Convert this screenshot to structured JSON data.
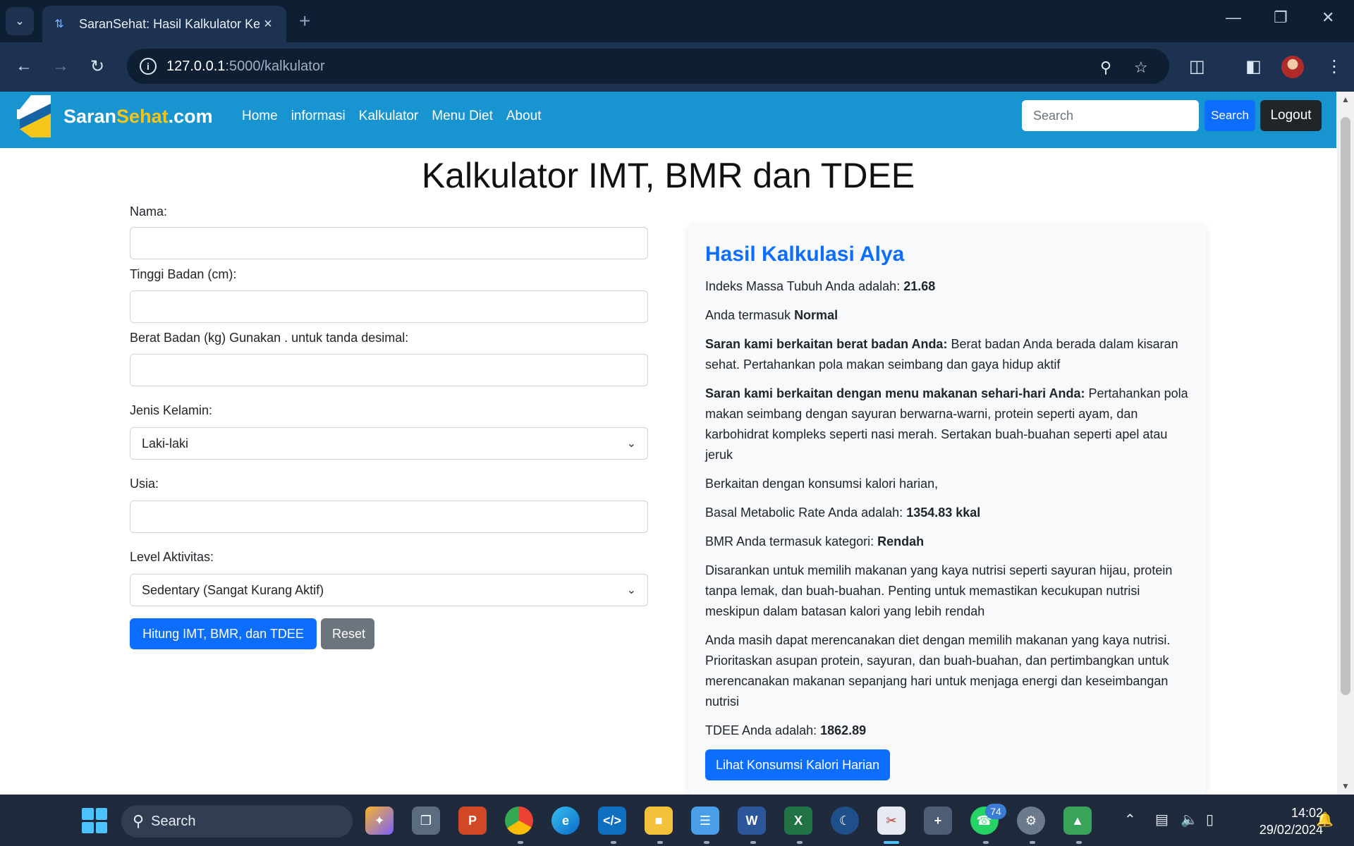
{
  "browser": {
    "tab_title": "SaranSehat: Hasil Kalkulator Ke",
    "url_host": "127.0.0.1",
    "url_path": ":5000/kalkulator"
  },
  "site": {
    "brand_part1": "Saran",
    "brand_part2": "Sehat",
    "brand_part3": ".com",
    "nav": [
      "Home",
      "informasi",
      "Kalkulator",
      "Menu Diet",
      "About"
    ],
    "search_placeholder": "Search",
    "search_button": "Search",
    "logout_button": "Logout",
    "brand_accent": "#f5c518",
    "navbar_color": "#1894d0"
  },
  "page": {
    "title": "Kalkulator IMT, BMR dan TDEE"
  },
  "form": {
    "nama_label": "Nama:",
    "tinggi_label": "Tinggi Badan (cm):",
    "berat_label": "Berat Badan (kg) Gunakan . untuk tanda desimal:",
    "jenis_kelamin_label": "Jenis Kelamin:",
    "jenis_kelamin_value": "Laki-laki",
    "usia_label": "Usia:",
    "aktivitas_label": "Level Aktivitas:",
    "aktivitas_value": "Sedentary (Sangat Kurang Aktif)",
    "hitung_button": "Hitung IMT, BMR, dan TDEE",
    "reset_button": "Reset"
  },
  "result": {
    "heading": "Hasil Kalkulasi Alya",
    "imt_text": "Indeks Massa Tubuh Anda adalah: ",
    "imt_value": "21.68",
    "kategori_text": "Anda termasuk ",
    "kategori_value": "Normal",
    "saran_berat_bold": "Saran kami berkaitan berat badan Anda:",
    "saran_berat_text": " Berat badan Anda berada dalam kisaran sehat. Pertahankan pola makan seimbang dan gaya hidup aktif",
    "saran_menu_bold": "Saran kami berkaitan dengan menu makanan sehari-hari Anda:",
    "saran_menu_text": " Pertahankan pola makan seimbang dengan sayuran berwarna-warni, protein seperti ayam, dan karbohidrat kompleks seperti nasi merah. Sertakan buah-buahan seperti apel atau jeruk",
    "kalori_intro": "Berkaitan dengan konsumsi kalori harian,",
    "bmr_text": "Basal Metabolic Rate Anda adalah: ",
    "bmr_value": "1354.83 kkal",
    "bmr_kategori_text": "BMR Anda termasuk kategori: ",
    "bmr_kategori_value": "Rendah",
    "saran_bmr": "Disarankan untuk memilih makanan yang kaya nutrisi seperti sayuran hijau, protein tanpa lemak, dan buah-buahan. Penting untuk memastikan kecukupan nutrisi meskipun dalam batasan kalori yang lebih rendah",
    "saran_diet": "Anda masih dapat merencanakan diet dengan memilih makanan yang kaya nutrisi. Prioritaskan asupan protein, sayuran, dan buah-buahan, dan pertimbangkan untuk merencanakan makanan sepanjang hari untuk menjaga energi dan keseimbangan nutrisi",
    "tdee_text": "TDEE Anda adalah: ",
    "tdee_value": "1862.89",
    "kalori_button": "Lihat Konsumsi Kalori Harian"
  },
  "taskbar": {
    "search_label": "Search",
    "whatsapp_badge": "74",
    "time": "14:02",
    "date": "29/02/2024"
  }
}
